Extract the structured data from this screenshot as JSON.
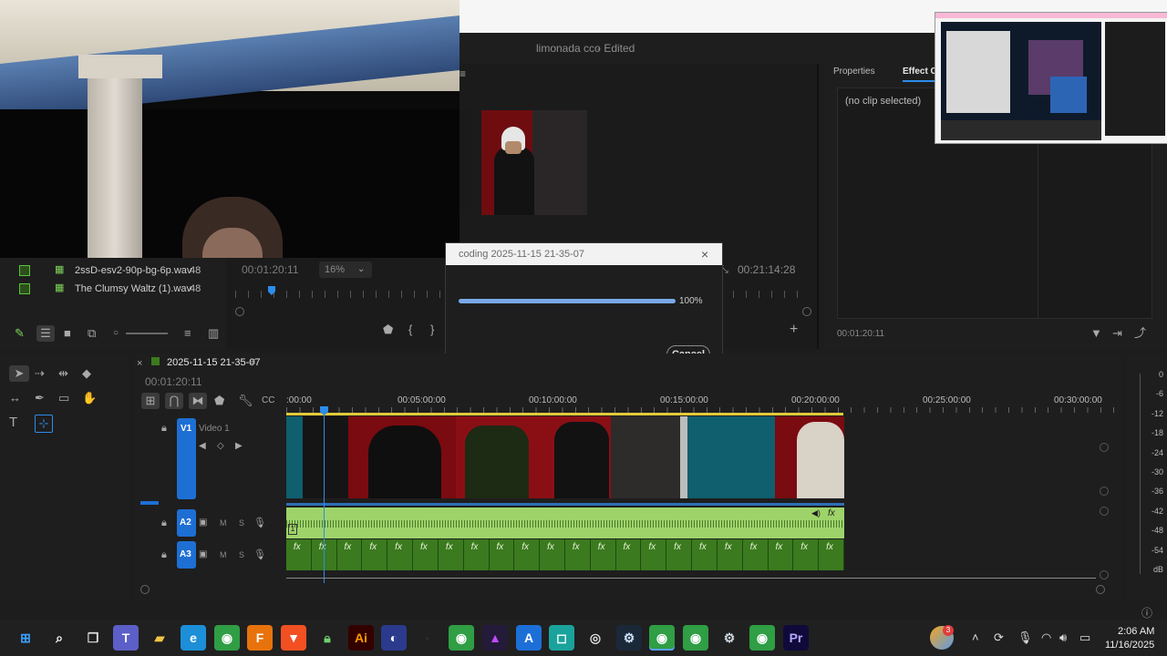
{
  "app": {
    "document_title": "limonada cco",
    "edited_suffix": "- Edited"
  },
  "effects_panel": {
    "tab_properties": "Properties",
    "tab_effect_controls": "Effect Co",
    "no_clip": "(no clip selected)",
    "timecode": "00:01:20:11"
  },
  "project_panel": {
    "items": [
      {
        "name": "2ssD-esv2-90p-bg-6p.wav",
        "rate": "48"
      },
      {
        "name": "The Clumsy Waltz (1).wav",
        "rate": "48"
      }
    ]
  },
  "source_monitor": {
    "timecode": "00:01:20:11",
    "zoom": "16%",
    "duration": "00:21:14:28"
  },
  "dialog": {
    "title": "coding 2025-11-15 21-35-07",
    "progress_label": "100%",
    "progress": 1.0,
    "cancel_label": "Cancel"
  },
  "timeline": {
    "sequence_name": "2025-11-15 21-35-07",
    "timecode": "00:01:20:11",
    "ruler": [
      ":00:00",
      "00:05:00:00",
      "00:10:00:00",
      "00:15:00:00",
      "00:20:00:00",
      "00:25:00:00",
      "00:30:00:00"
    ],
    "tracks": {
      "v1": {
        "label": "V1",
        "name": "Video 1"
      },
      "a2": {
        "label": "A2",
        "m": "M",
        "s": "S"
      },
      "a3": {
        "label": "A3",
        "m": "M",
        "s": "S"
      }
    },
    "fx_label": "fx",
    "clip_number": "1"
  },
  "meters": {
    "labels": [
      "0",
      "-6",
      "-12",
      "-18",
      "-24",
      "-30",
      "-36",
      "-42",
      "-48",
      "-54",
      "dB"
    ]
  },
  "taskbar": {
    "time": "2:06 AM",
    "date": "11/16/2025",
    "badge": "3",
    "icons": [
      "windows-start-icon",
      "search-icon",
      "task-view-icon",
      "teams-icon",
      "file-explorer-icon",
      "edge-icon",
      "chrome-icon",
      "fusion-icon",
      "brave-icon",
      "lock-app-icon",
      "illustrator-icon",
      "app-circle-icon",
      "blank-icon",
      "chrome-icon",
      "affinity-icon",
      "app-store-icon",
      "app-b-icon",
      "app-c-icon",
      "steam-icon",
      "chrome-icon",
      "chrome-icon",
      "settings-icon",
      "chrome-icon",
      "premiere-icon"
    ]
  },
  "colors": {
    "accent_blue": "#2d8ceb",
    "track_v1_blue": "#1e6fd4",
    "audio_green": "#9ed36a",
    "audio_dark_green": "#3b7a1e",
    "playhead": "#2d8ceb"
  }
}
